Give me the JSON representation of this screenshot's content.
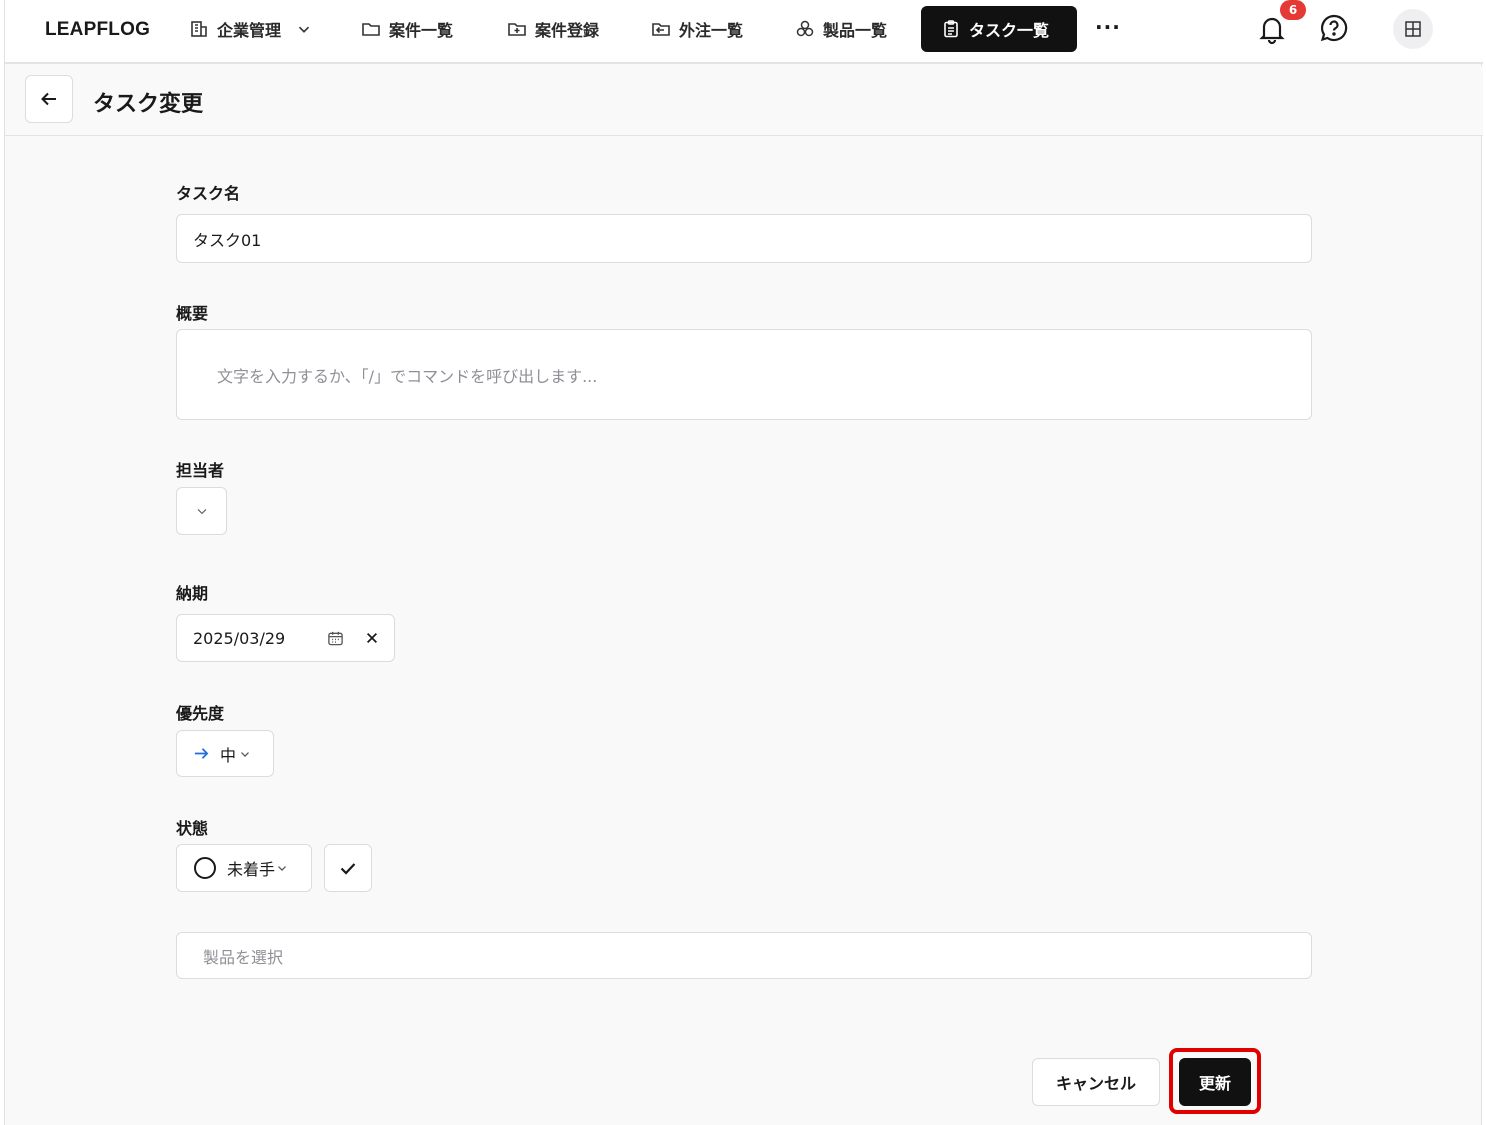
{
  "app": {
    "logo": "LEAPFLOG"
  },
  "nav": {
    "items": [
      {
        "label": "企業管理",
        "icon": "building-icon",
        "dropdown": true
      },
      {
        "label": "案件一覧",
        "icon": "folder-icon"
      },
      {
        "label": "案件登録",
        "icon": "folder-plus-icon"
      },
      {
        "label": "外注一覧",
        "icon": "folder-export-icon"
      },
      {
        "label": "製品一覧",
        "icon": "cubes-icon"
      },
      {
        "label": "タスク一覧",
        "icon": "clipboard-icon",
        "active": true
      }
    ],
    "more": "···",
    "notifications_count": "6"
  },
  "page": {
    "title": "タスク変更"
  },
  "form": {
    "task_name_label": "タスク名",
    "task_name_value": "タスク01",
    "summary_label": "概要",
    "summary_placeholder": "文字を入力するか、「/」でコマンドを呼び出します...",
    "assignee_label": "担当者",
    "due_label": "納期",
    "due_value": "2025/03/29",
    "priority_label": "優先度",
    "priority_value": "中",
    "status_label": "状態",
    "status_value": "未着手",
    "product_placeholder": "製品を選択"
  },
  "actions": {
    "cancel": "キャンセル",
    "update": "更新"
  },
  "colors": {
    "active_nav_bg": "#111111",
    "badge": "#e53935",
    "priority_arrow": "#1e6fd9",
    "highlight": "#e10000"
  }
}
